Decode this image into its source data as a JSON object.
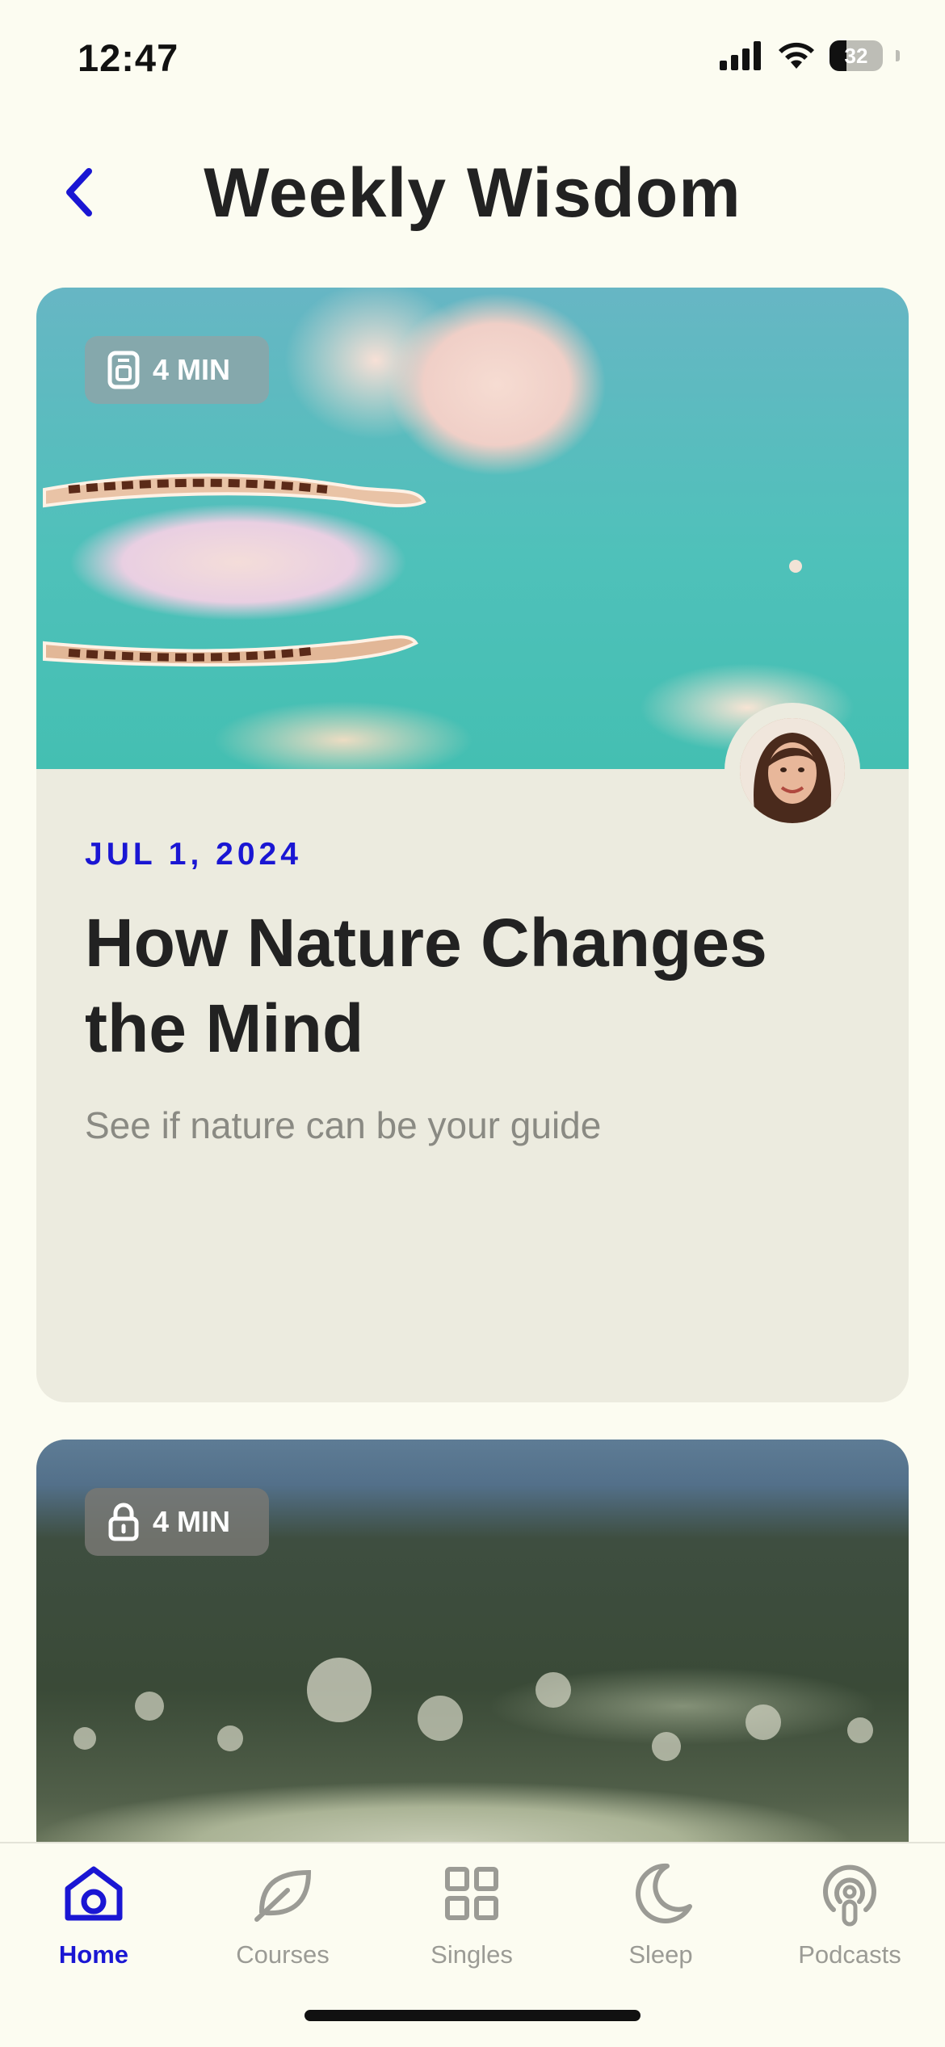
{
  "status_bar": {
    "time": "12:47",
    "battery_level": "32",
    "icons": [
      "signal-icon",
      "wifi-icon",
      "battery-icon"
    ]
  },
  "header": {
    "title": "Weekly Wisdom",
    "back_icon": "chevron-left-icon"
  },
  "cards": [
    {
      "duration": "4 MIN",
      "duration_icon": "audio-device-icon",
      "date": "JUL 1, 2024",
      "title": "How Nature Changes the Mind",
      "subtitle": "See if nature can be your guide",
      "has_avatar": true
    },
    {
      "duration": "4 MIN",
      "duration_icon": "lock-icon"
    }
  ],
  "tab_bar": {
    "items": [
      {
        "label": "Home",
        "icon": "home-icon",
        "active": true
      },
      {
        "label": "Courses",
        "icon": "leaf-icon",
        "active": false
      },
      {
        "label": "Singles",
        "icon": "grid-icon",
        "active": false
      },
      {
        "label": "Sleep",
        "icon": "moon-icon",
        "active": false
      },
      {
        "label": "Podcasts",
        "icon": "podcast-icon",
        "active": false
      }
    ]
  },
  "colors": {
    "accent": "#1a16d3",
    "background": "#fcfcf1",
    "card": "#ecebdf",
    "inactive": "#9b9b95"
  }
}
